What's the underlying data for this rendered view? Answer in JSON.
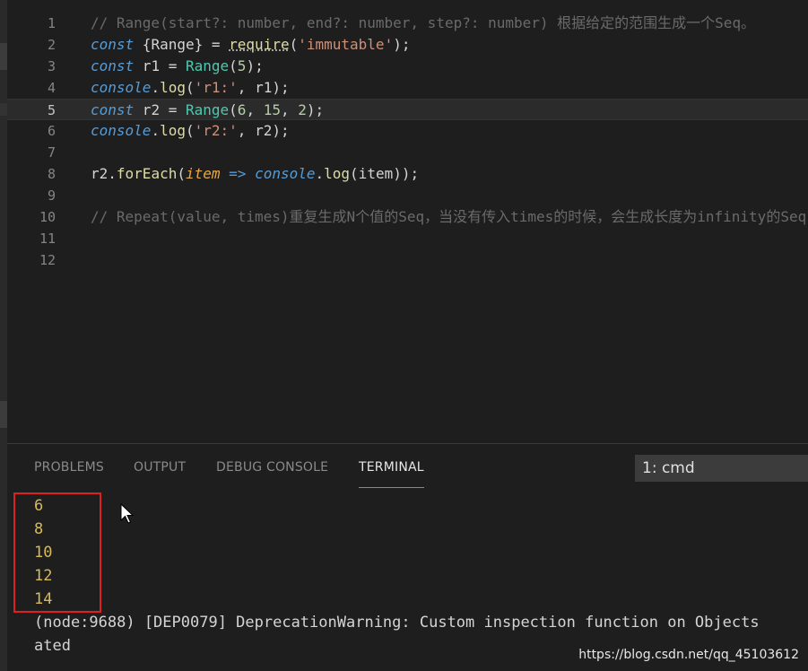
{
  "editor": {
    "lines": [
      {
        "n": "1",
        "tokens": [
          [
            "c-comment",
            "// Range(start?: number, end?: number, step?: number) 根据给定的范围生成一个Seq。"
          ]
        ]
      },
      {
        "n": "2",
        "tokens": [
          [
            "c-kw",
            "const"
          ],
          [
            "c-var",
            " {Range} "
          ],
          [
            "c-op",
            "="
          ],
          [
            "c-var",
            " "
          ],
          [
            "c-fn squig",
            "require"
          ],
          [
            "c-var",
            "("
          ],
          [
            "c-str",
            "'immutable'"
          ],
          [
            "c-var",
            ");"
          ]
        ]
      },
      {
        "n": "3",
        "tokens": [
          [
            "c-kw",
            "const"
          ],
          [
            "c-var",
            " r1 "
          ],
          [
            "c-op",
            "="
          ],
          [
            "c-var",
            " "
          ],
          [
            "c-cls",
            "Range"
          ],
          [
            "c-var",
            "("
          ],
          [
            "c-num",
            "5"
          ],
          [
            "c-var",
            ");"
          ]
        ]
      },
      {
        "n": "4",
        "tokens": [
          [
            "c-kw",
            "console"
          ],
          [
            "c-var",
            "."
          ],
          [
            "c-fn",
            "log"
          ],
          [
            "c-var",
            "("
          ],
          [
            "c-str",
            "'r1:'"
          ],
          [
            "c-var",
            ", r1);"
          ]
        ]
      },
      {
        "n": "5",
        "tokens": [
          [
            "c-kw",
            "const"
          ],
          [
            "c-var",
            " r2 "
          ],
          [
            "c-op",
            "="
          ],
          [
            "c-var",
            " "
          ],
          [
            "c-cls",
            "Range"
          ],
          [
            "c-var",
            "("
          ],
          [
            "c-num",
            "6"
          ],
          [
            "c-var",
            ", "
          ],
          [
            "c-num",
            "15"
          ],
          [
            "c-var",
            ", "
          ],
          [
            "c-num",
            "2"
          ],
          [
            "c-var",
            ");"
          ]
        ]
      },
      {
        "n": "6",
        "tokens": [
          [
            "c-kw",
            "console"
          ],
          [
            "c-var",
            "."
          ],
          [
            "c-fn",
            "log"
          ],
          [
            "c-var",
            "("
          ],
          [
            "c-str",
            "'r2:'"
          ],
          [
            "c-var",
            ", r2);"
          ]
        ]
      },
      {
        "n": "7",
        "tokens": []
      },
      {
        "n": "8",
        "tokens": [
          [
            "c-var",
            "r2."
          ],
          [
            "c-fn",
            "forEach"
          ],
          [
            "c-var",
            "("
          ],
          [
            "c-param",
            "item"
          ],
          [
            "c-var",
            " "
          ],
          [
            "c-kw",
            "=>"
          ],
          [
            "c-var",
            " "
          ],
          [
            "c-kw",
            "console"
          ],
          [
            "c-var",
            "."
          ],
          [
            "c-fn",
            "log"
          ],
          [
            "c-var",
            "(item));"
          ]
        ]
      },
      {
        "n": "9",
        "tokens": []
      },
      {
        "n": "10",
        "tokens": [
          [
            "c-comment",
            "// Repeat(value, times)重复生成N个值的Seq，当没有传入times的时候，会生成长度为infinity的Seq"
          ]
        ]
      },
      {
        "n": "11",
        "tokens": []
      },
      {
        "n": "12",
        "tokens": []
      }
    ],
    "active_line": 5
  },
  "panel": {
    "tabs": [
      "PROBLEMS",
      "OUTPUT",
      "DEBUG CONSOLE",
      "TERMINAL"
    ],
    "active_tab": "TERMINAL",
    "terminal_select": "1: cmd"
  },
  "terminal": {
    "output_numbers": [
      "6",
      "8",
      "10",
      "12",
      "14"
    ],
    "warning_line1": "(node:9688) [DEP0079] DeprecationWarning: Custom inspection function on Objects",
    "warning_line2": "ated"
  },
  "watermark": "https://blog.csdn.net/qq_45103612",
  "colors": {
    "highlight_box": "#e02020",
    "terminal_output": "#d7ba5a"
  }
}
